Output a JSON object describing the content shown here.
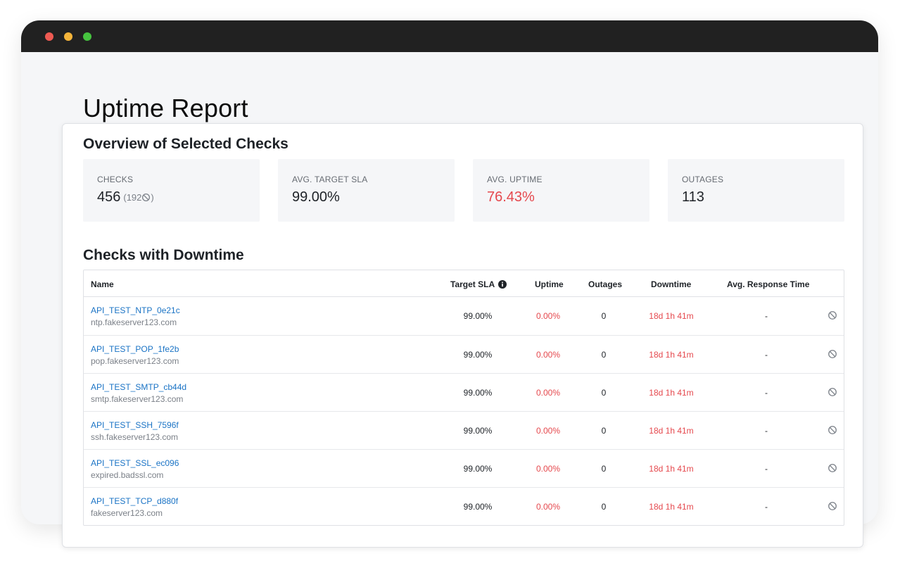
{
  "window": {
    "controls": [
      "close",
      "minimize",
      "maximize"
    ]
  },
  "page": {
    "title": "Uptime Report"
  },
  "overview": {
    "title": "Overview of Selected Checks",
    "stats": [
      {
        "label": "CHECKS",
        "value": "456",
        "sub": "(192",
        "sub_end": ")"
      },
      {
        "label": "AVG. TARGET SLA",
        "value": "99.00%"
      },
      {
        "label": "AVG. UPTIME",
        "value": "76.43%"
      },
      {
        "label": "OUTAGES",
        "value": "113"
      }
    ]
  },
  "downtime": {
    "title": "Checks with Downtime",
    "columns": {
      "name": "Name",
      "target_sla": "Target SLA",
      "uptime": "Uptime",
      "outages": "Outages",
      "downtime": "Downtime",
      "avg_response": "Avg. Response Time"
    },
    "rows": [
      {
        "name": "API_TEST_NTP_0e21c",
        "host": "ntp.fakeserver123.com",
        "sla": "99.00%",
        "uptime": "0.00%",
        "outages": "0",
        "downtime": "18d 1h 41m",
        "response": "-"
      },
      {
        "name": "API_TEST_POP_1fe2b",
        "host": "pop.fakeserver123.com",
        "sla": "99.00%",
        "uptime": "0.00%",
        "outages": "0",
        "downtime": "18d 1h 41m",
        "response": "-"
      },
      {
        "name": "API_TEST_SMTP_cb44d",
        "host": "smtp.fakeserver123.com",
        "sla": "99.00%",
        "uptime": "0.00%",
        "outages": "0",
        "downtime": "18d 1h 41m",
        "response": "-"
      },
      {
        "name": "API_TEST_SSH_7596f",
        "host": "ssh.fakeserver123.com",
        "sla": "99.00%",
        "uptime": "0.00%",
        "outages": "0",
        "downtime": "18d 1h 41m",
        "response": "-"
      },
      {
        "name": "API_TEST_SSL_ec096",
        "host": "expired.badssl.com",
        "sla": "99.00%",
        "uptime": "0.00%",
        "outages": "0",
        "downtime": "18d 1h 41m",
        "response": "-"
      },
      {
        "name": "API_TEST_TCP_d880f",
        "host": "fakeserver123.com",
        "sla": "99.00%",
        "uptime": "0.00%",
        "outages": "0",
        "downtime": "18d 1h 41m",
        "response": "-"
      }
    ]
  },
  "colors": {
    "accent_link": "#1a73c5",
    "bad": "#e5484d",
    "titlebar": "#212121"
  }
}
